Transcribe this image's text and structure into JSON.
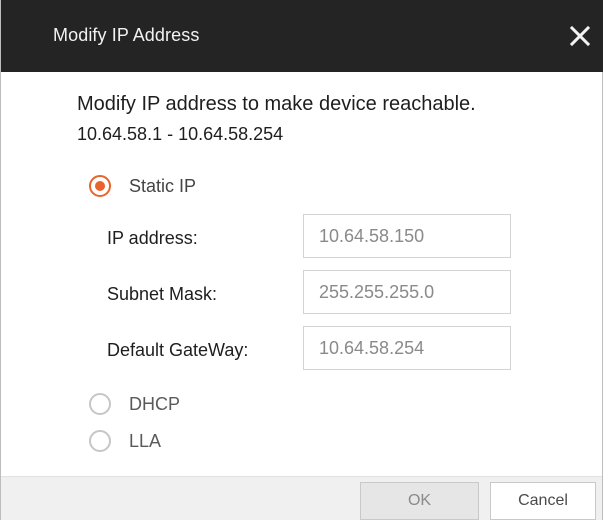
{
  "dialog": {
    "title": "Modify IP Address",
    "close_icon": "close-icon",
    "message_line1": "Modify IP address to make device reachable.",
    "message_line2": "10.64.58.1 - 10.64.58.254"
  },
  "modes": {
    "selected": "Static IP",
    "static_ip_label": "Static IP",
    "dhcp_label": "DHCP",
    "lla_label": "LLA"
  },
  "fields": {
    "ip_address": {
      "label": "IP address:",
      "value": "10.64.58.150"
    },
    "subnet_mask": {
      "label": "Subnet Mask:",
      "value": "255.255.255.0"
    },
    "default_gateway": {
      "label": "Default GateWay:",
      "value": "10.64.58.254"
    }
  },
  "buttons": {
    "ok_label": "OK",
    "cancel_label": "Cancel"
  },
  "colors": {
    "accent": "#e8642c",
    "titlebar": "#242424"
  }
}
